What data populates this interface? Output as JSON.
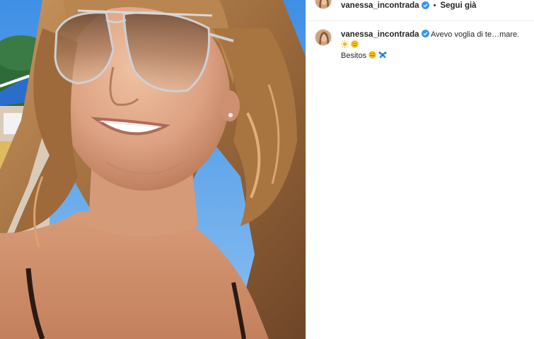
{
  "post": {
    "author": "vanessa_incontrada",
    "follow_status": "Segui già",
    "separator": "•",
    "caption_text": "Avevo voglia di te…mare.",
    "caption_second_line": "Besitos",
    "icons": [
      "verified-badge-icon",
      "sun-emoji-icon",
      "smiling-blush-emoji-icon",
      "grin-emoji-icon",
      "butterfly-emoji-icon"
    ]
  },
  "colors": {
    "verified": "#3897f0",
    "text": "#262626",
    "divider": "#efefef"
  }
}
